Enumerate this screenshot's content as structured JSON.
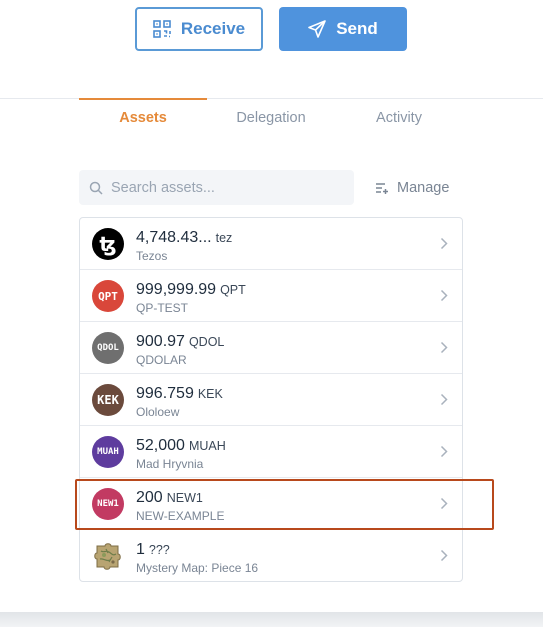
{
  "actions": {
    "receive_label": "Receive",
    "send_label": "Send",
    "receive_icon": "qr-code-icon",
    "send_icon": "paper-plane-icon"
  },
  "tabs": [
    {
      "label": "Assets",
      "active": true
    },
    {
      "label": "Delegation",
      "active": false
    },
    {
      "label": "Activity",
      "active": false
    }
  ],
  "search": {
    "placeholder": "Search assets...",
    "value": "",
    "icon": "search-icon"
  },
  "manage": {
    "label": "Manage",
    "icon": "manage-list-icon"
  },
  "assets": [
    {
      "amount": "4,748.43...",
      "symbol": "tez",
      "name": "Tezos",
      "icon": "tezos-logo-icon",
      "color": "#000000",
      "badge": "ꜩ"
    },
    {
      "amount": "999,999.99",
      "symbol": "QPT",
      "name": "QP-TEST",
      "icon": "qpt-token-icon",
      "color": "#d9473a",
      "badge": "QPT"
    },
    {
      "amount": "900.97",
      "symbol": "QDOL",
      "name": "QDOLAR",
      "icon": "qdol-token-icon",
      "color": "#6f6f6f",
      "badge": "QDOL"
    },
    {
      "amount": "996.759",
      "symbol": "KEK",
      "name": "Ololoew",
      "icon": "kek-token-icon",
      "color": "#6b4a3c",
      "badge": "KEK"
    },
    {
      "amount": "52,000",
      "symbol": "MUAH",
      "name": "Mad Hryvnia",
      "icon": "muah-token-icon",
      "color": "#5e3c9e",
      "badge": "MUAH"
    },
    {
      "amount": "200",
      "symbol": "NEW1",
      "name": "NEW-EXAMPLE",
      "icon": "new1-token-icon",
      "color": "#c23a62",
      "badge": "NEW1",
      "highlighted": true
    },
    {
      "amount": "1",
      "symbol": "???",
      "name": "Mystery Map: Piece 16",
      "icon": "map-piece-image-icon",
      "color": "#9a8a5a",
      "badge": ""
    }
  ],
  "colors": {
    "accent": "#e58a3a",
    "primary_blue": "#4f93dd",
    "highlight_border": "#b8491c"
  }
}
